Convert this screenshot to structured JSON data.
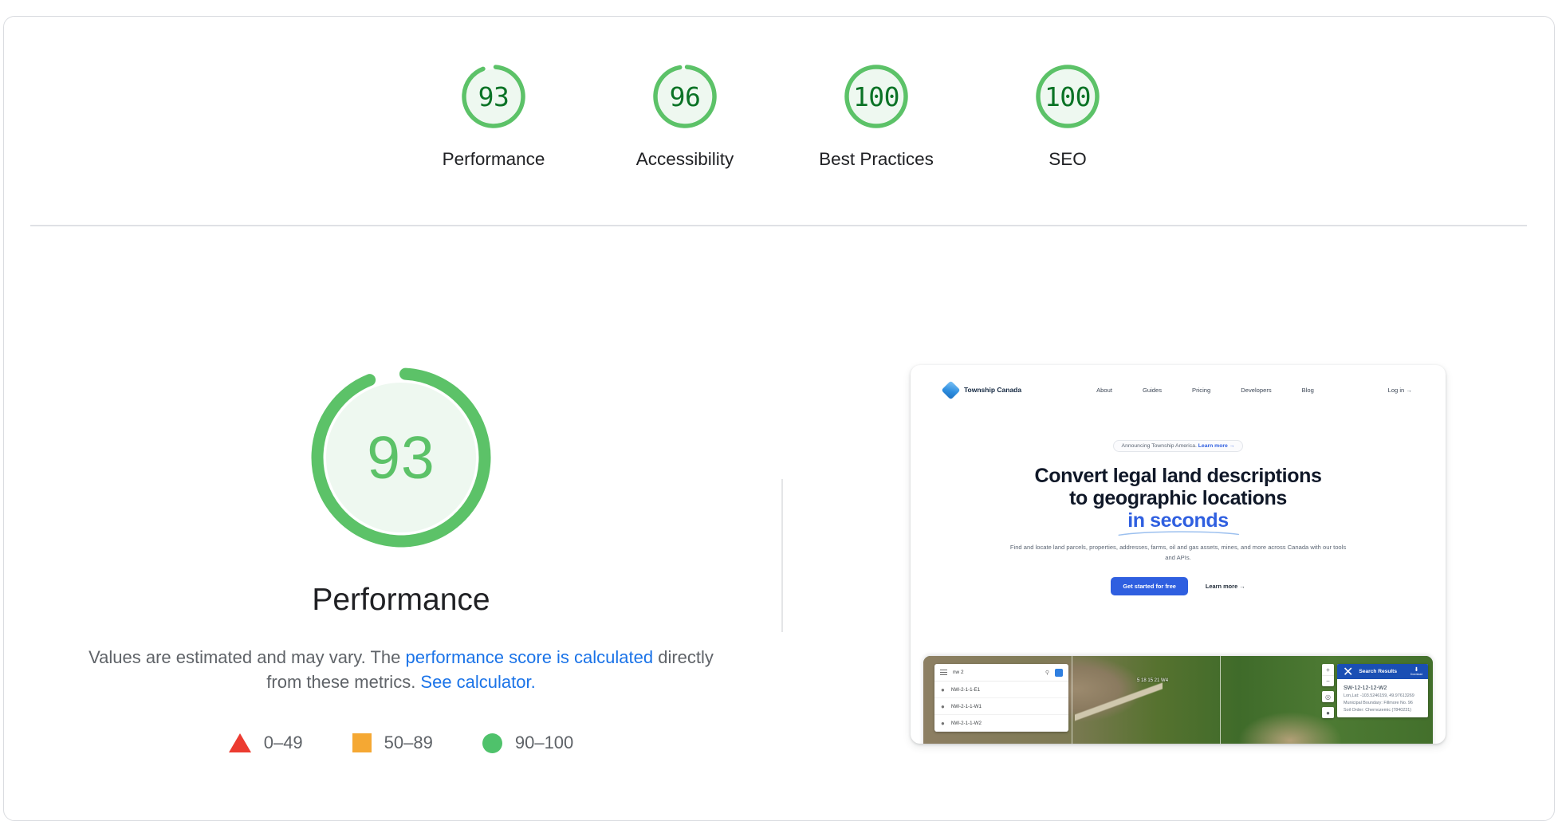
{
  "report": {
    "scores": [
      {
        "value": "93",
        "label": "Performance",
        "percent": 93,
        "color": "#5cc268"
      },
      {
        "value": "96",
        "label": "Accessibility",
        "percent": 96,
        "color": "#5cc268"
      },
      {
        "value": "100",
        "label": "Best Practices",
        "percent": 100,
        "color": "#5cc268"
      },
      {
        "value": "100",
        "label": "SEO",
        "percent": 100,
        "color": "#5cc268"
      }
    ],
    "detail": {
      "score": "93",
      "percent": 93,
      "title": "Performance",
      "description_lead": "Values are estimated and may vary. The ",
      "link_calculated": "performance score is calculated",
      "description_mid": " directly from these metrics. ",
      "link_calculator": "See calculator."
    },
    "legend": [
      {
        "shape": "triangle-fail-icon",
        "range": "0–49",
        "color": "#ec3b30"
      },
      {
        "shape": "square-average-icon",
        "range": "50–89",
        "color": "#f5a833"
      },
      {
        "shape": "circle-pass-icon",
        "range": "90–100",
        "color": "#4fc26b"
      }
    ]
  },
  "screenshot": {
    "nav": {
      "brand": "Township Canada",
      "links": [
        "About",
        "Guides",
        "Pricing",
        "Developers",
        "Blog"
      ],
      "login": "Log in →"
    },
    "hero": {
      "badge_text": "Announcing Township America. ",
      "badge_link": "Learn more →",
      "heading_line1": "Convert legal land descriptions",
      "heading_line2": "to geographic locations",
      "heading_accent": "in seconds",
      "subtitle": "Find and locate land parcels, properties, addresses, farms, oil and gas assets, mines, and more across Canada with our tools and APIs.",
      "cta_primary": "Get started for free",
      "cta_secondary": "Learn more →"
    },
    "map": {
      "search_value": "nw 2",
      "parcel_label": "5 18 15 21 W4",
      "results": [
        "NW-2-1-1-E1",
        "NW-2-1-1-W1",
        "NW-2-1-1-W2"
      ],
      "panel_title": "Search Results",
      "download_label": "Download",
      "selected_title": "SW-12-12-12-W2",
      "selected_meta": [
        "Lon,Lat: -103.5246159, 49.97613269",
        "Municipal Boundary: Fillmore No. 96",
        "Soil Order: Chernozemic (7840231)"
      ]
    }
  }
}
